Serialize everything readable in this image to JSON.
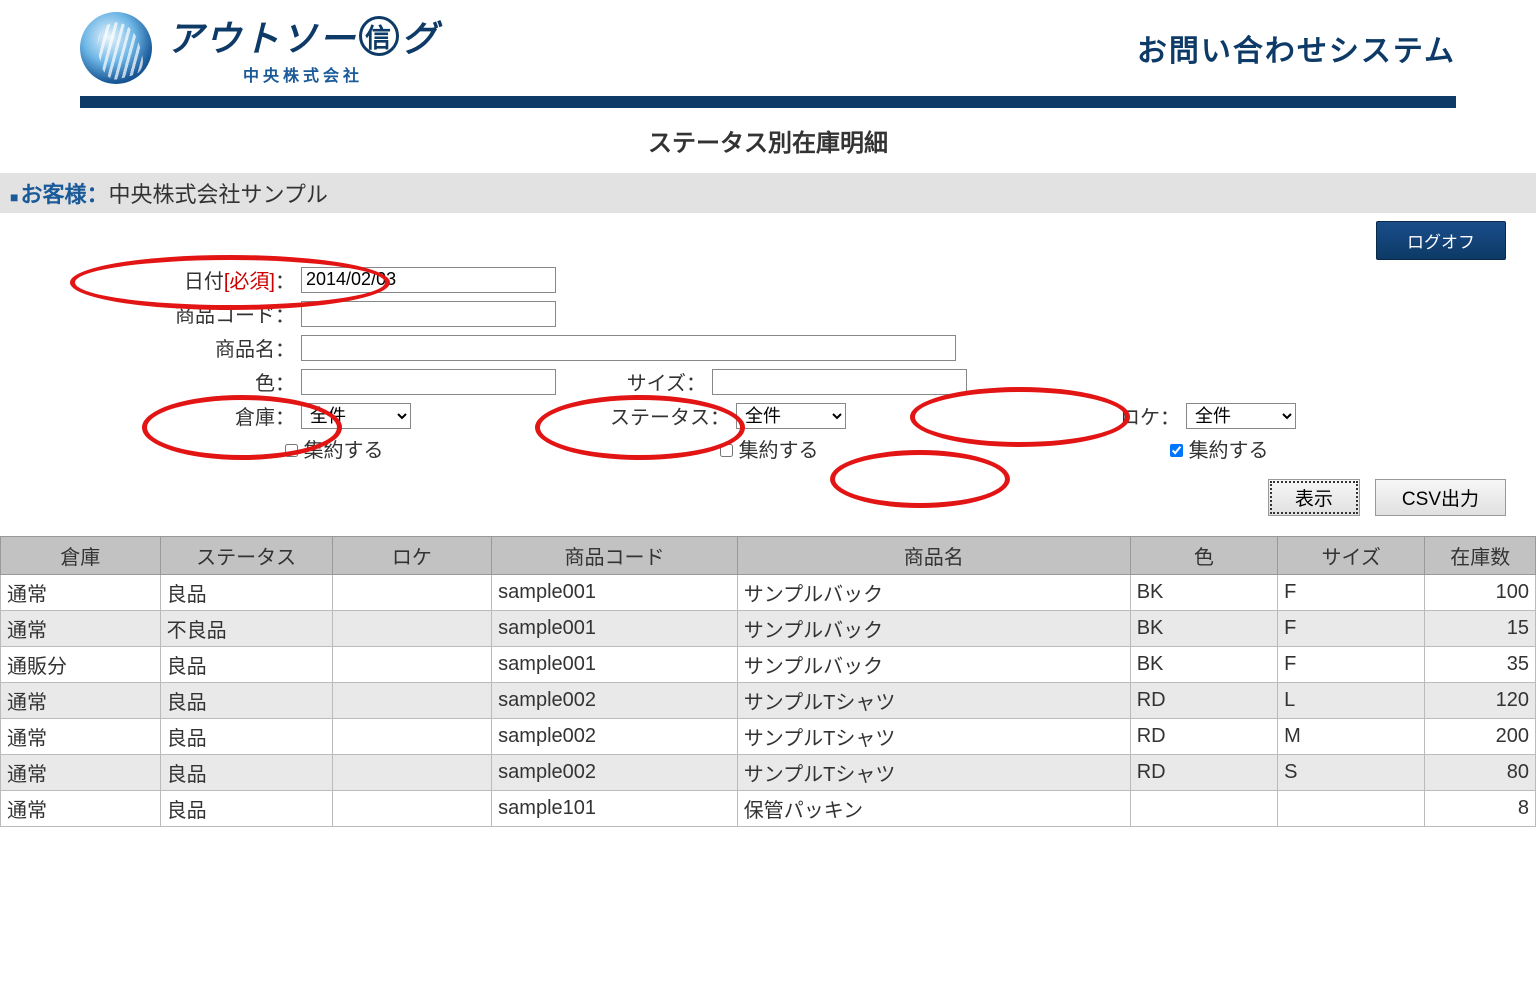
{
  "header": {
    "logo_main_prefix": "アウトソー",
    "logo_main_circle_char": "信",
    "logo_main_suffix": "グ",
    "logo_sub": "中央株式会社",
    "system_title": "お問い合わせシステム"
  },
  "page_title": "ステータス別在庫明細",
  "customer": {
    "label": "お客様",
    "separator": "：",
    "value": "中央株式会社サンプル"
  },
  "logoff_label": "ログオフ",
  "form": {
    "date_label": "日付",
    "required_text": "[必須]",
    "date_value": "2014/02/03",
    "product_code_label": "商品コード",
    "product_code_value": "",
    "product_name_label": "商品名",
    "product_name_value": "",
    "color_label": "色",
    "color_value": "",
    "size_label": "サイズ",
    "size_value": "",
    "warehouse_label": "倉庫",
    "warehouse_value": "全件",
    "status_label": "ステータス",
    "status_value": "全件",
    "location_label": "ロケ",
    "location_value": "全件",
    "aggregate_label": "集約する",
    "warehouse_aggregate_checked": false,
    "status_aggregate_checked": false,
    "location_aggregate_checked": true,
    "colon": "："
  },
  "buttons": {
    "display": "表示",
    "csv": "CSV出力"
  },
  "table": {
    "columns": [
      "倉庫",
      "ステータス",
      "ロケ",
      "商品コード",
      "商品名",
      "色",
      "サイズ",
      "在庫数"
    ],
    "rows": [
      {
        "warehouse": "通常",
        "status": "良品",
        "location": "",
        "code": "sample001",
        "name": "サンプルバック",
        "color": "BK",
        "size": "F",
        "qty": 100
      },
      {
        "warehouse": "通常",
        "status": "不良品",
        "location": "",
        "code": "sample001",
        "name": "サンプルバック",
        "color": "BK",
        "size": "F",
        "qty": 15
      },
      {
        "warehouse": "通販分",
        "status": "良品",
        "location": "",
        "code": "sample001",
        "name": "サンプルバック",
        "color": "BK",
        "size": "F",
        "qty": 35
      },
      {
        "warehouse": "通常",
        "status": "良品",
        "location": "",
        "code": "sample002",
        "name": "サンプルTシャツ",
        "color": "RD",
        "size": "L",
        "qty": 120
      },
      {
        "warehouse": "通常",
        "status": "良品",
        "location": "",
        "code": "sample002",
        "name": "サンプルTシャツ",
        "color": "RD",
        "size": "M",
        "qty": 200
      },
      {
        "warehouse": "通常",
        "status": "良品",
        "location": "",
        "code": "sample002",
        "name": "サンプルTシャツ",
        "color": "RD",
        "size": "S",
        "qty": 80
      },
      {
        "warehouse": "通常",
        "status": "良品",
        "location": "",
        "code": "sample101",
        "name": "保管パッキン",
        "color": "",
        "size": "",
        "qty": 8
      }
    ]
  }
}
